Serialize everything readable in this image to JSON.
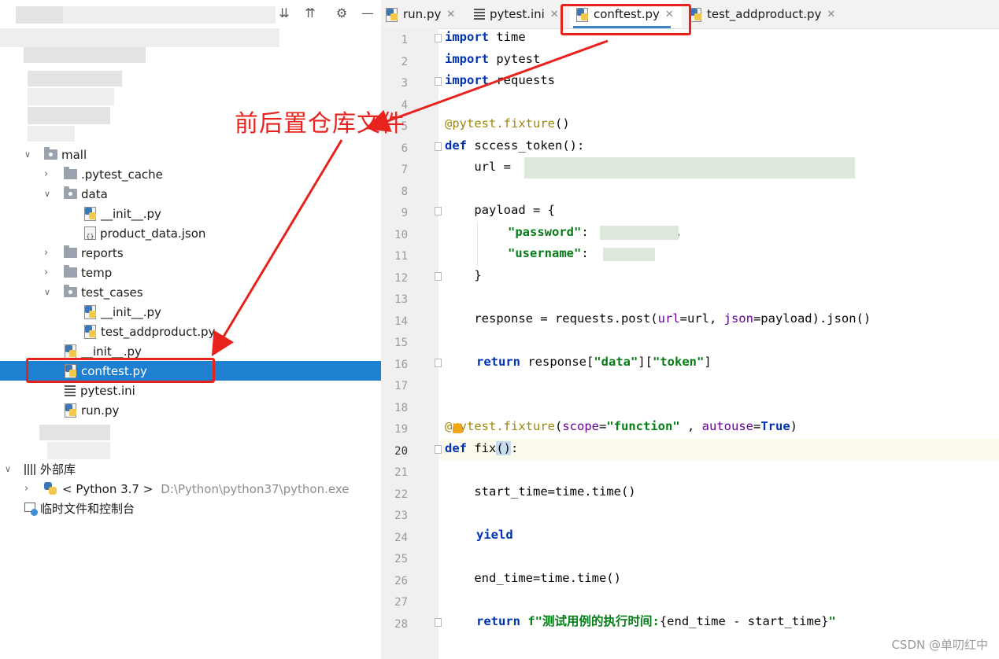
{
  "project_tree": {
    "items": [
      {
        "label": "mall",
        "type": "folder",
        "expanded": true
      },
      {
        "label": ".pytest_cache",
        "type": "folder",
        "expanded": false
      },
      {
        "label": "data",
        "type": "folder",
        "expanded": true
      },
      {
        "label": "__init__.py",
        "type": "python-file"
      },
      {
        "label": "product_data.json",
        "type": "json-file"
      },
      {
        "label": "reports",
        "type": "folder",
        "expanded": false
      },
      {
        "label": "temp",
        "type": "folder",
        "expanded": false
      },
      {
        "label": "test_cases",
        "type": "folder",
        "expanded": true
      },
      {
        "label": "__init__.py",
        "type": "python-file"
      },
      {
        "label": "test_addproduct.py",
        "type": "python-file"
      },
      {
        "label": "__init__.py",
        "type": "python-file"
      },
      {
        "label": "conftest.py",
        "type": "python-file",
        "selected": true
      },
      {
        "label": "pytest.ini",
        "type": "ini-file"
      },
      {
        "label": "run.py",
        "type": "python-file"
      }
    ],
    "external_libraries": "外部库",
    "python_sdk": {
      "label": "< Python 3.7 >",
      "path": "D:\\Python\\python37\\python.exe"
    },
    "scratches": "临时文件和控制台"
  },
  "tabs": [
    {
      "label": "run.py",
      "active": false
    },
    {
      "label": "pytest.ini",
      "active": false
    },
    {
      "label": "conftest.py",
      "active": true
    },
    {
      "label": "test_addproduct.py",
      "active": false
    }
  ],
  "editor": {
    "current_line": 20,
    "line_numbers": [
      "1",
      "2",
      "3",
      "4",
      "5",
      "6",
      "7",
      "8",
      "9",
      "10",
      "11",
      "12",
      "13",
      "14",
      "15",
      "16",
      "17",
      "18",
      "19",
      "20",
      "21",
      "22",
      "23",
      "24",
      "25",
      "26",
      "27",
      "28"
    ],
    "code": {
      "l1_kw": "import",
      "l1_rest": " time",
      "l2_kw": "import",
      "l2_rest": " pytest",
      "l3_kw": "import",
      "l3_rest": " requests",
      "l5": "@pytest.fixture",
      "l5_rest": "()",
      "l6_kw": "def",
      "l6_rest": " sccess_token():",
      "l7": "    url = ",
      "l9": "    payload = {",
      "l10_str": "\"password\"",
      "l10_rest": ": ",
      "l10_tail": ",",
      "l11_str": "\"username\"",
      "l11_rest": ": ",
      "l12": "    }",
      "l14_a": "    response = requests.post(",
      "l14_p1": "url",
      "l14_b": "=url, ",
      "l14_p2": "json",
      "l14_c": "=payload).json()",
      "l16_kw": "return",
      "l16_a": " response[",
      "l16_s1": "\"data\"",
      "l16_b": "][",
      "l16_s2": "\"token\"",
      "l16_c": "]",
      "l19_dec": "@pytest.fixture",
      "l19_a": "(",
      "l19_p1": "scope",
      "l19_b": "=",
      "l19_s": "\"function\"",
      "l19_c": " , ",
      "l19_p2": "autouse",
      "l19_d": "=",
      "l19_kw": "True",
      "l19_e": ")",
      "l20_kw": "def",
      "l20_rest": " fix",
      "l20_paren": "()",
      "l20_tail": ":",
      "l22": "    start_time=time.time()",
      "l24_kw": "yield",
      "l26": "    end_time=time.time()",
      "l28_kw": "return",
      "l28_str": " f\"测试用例的执行时间:",
      "l28_a": "{end_time - start_time}",
      "l28_str2": "\""
    }
  },
  "annotation": {
    "text": "前后置仓库文件",
    "color": "#e8231e"
  },
  "watermark": "CSDN @单叨红中",
  "colors": {
    "selection": "#1e80d0",
    "keyword": "#0033b3",
    "string": "#067d17",
    "decorator": "#9e880d",
    "param": "#660099"
  }
}
